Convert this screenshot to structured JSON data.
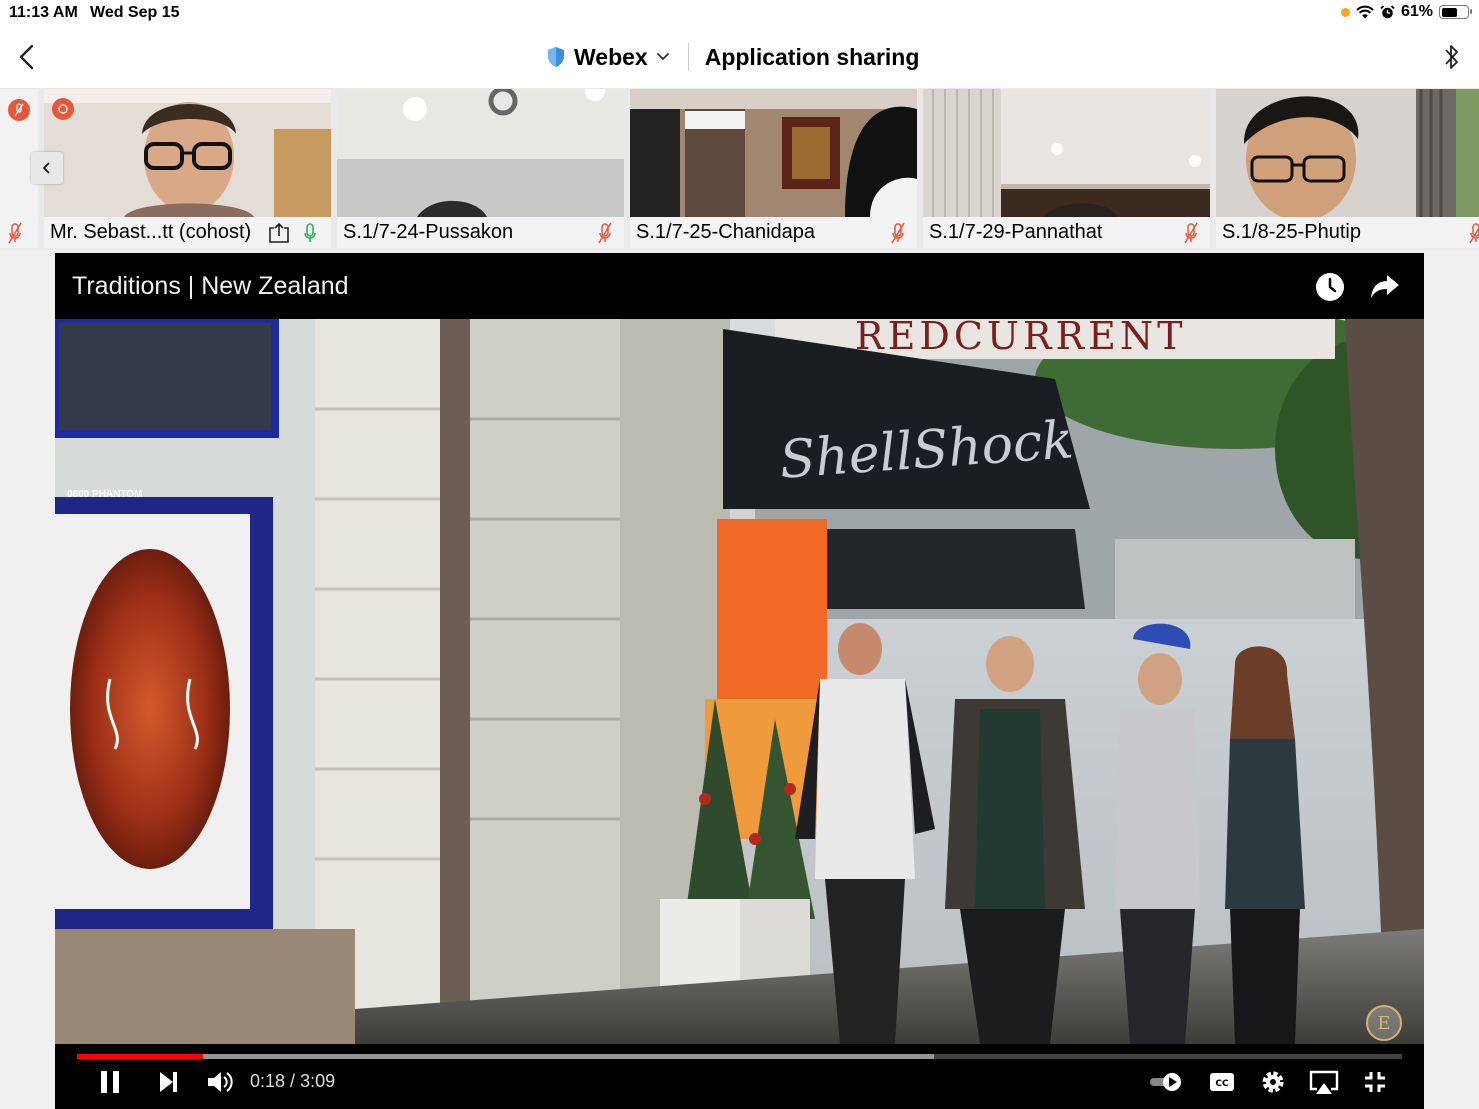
{
  "status_bar": {
    "time": "11:13 AM",
    "date": "Wed Sep 15",
    "battery": "61%",
    "battery_level": 0.61
  },
  "nav": {
    "app_name": "Webex",
    "title": "Application sharing",
    "icons": [
      "back-chevron-icon",
      "shield-icon",
      "chevron-down-icon",
      "bluetooth-icon"
    ]
  },
  "participants": [
    {
      "name": "Mr. Sebast...tt (cohost)",
      "muted": false,
      "sharing": true
    },
    {
      "name": "S.1/7-24-Pussakon",
      "muted": true
    },
    {
      "name": "S.1/7-25-Chanidapa",
      "muted": true
    },
    {
      "name": "S.1/7-29-Pannathat",
      "muted": true
    },
    {
      "name": "S.1/8-25-Phutip",
      "muted": true
    }
  ],
  "video": {
    "title": "Traditions | New Zealand",
    "time_current": "0:18",
    "time_separator": " / ",
    "time_total": "3:09",
    "played_fraction": 0.095,
    "buffered_fraction": 0.647,
    "scene_text": {
      "shop": "ShellShock",
      "banner": "REDCURRENT",
      "sign": "0800 PHANTOM"
    },
    "channel_badge": "E"
  },
  "colors": {
    "accent_red": "#ff0000",
    "muted_red": "#e8573b",
    "mic_green": "#2db84b",
    "webex_blue": "#3b8fe0"
  }
}
